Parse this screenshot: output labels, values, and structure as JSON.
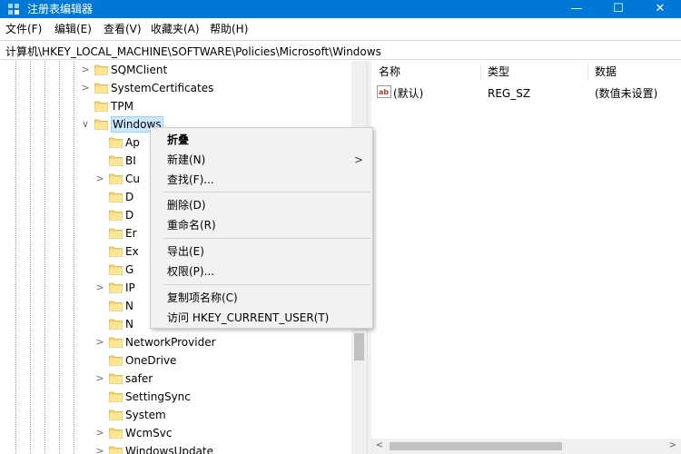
{
  "window": {
    "title": "注册表编辑器",
    "controls": {
      "minimize": "—",
      "maximize": "☐",
      "close": "✕"
    },
    "icon": "registry-editor-icon",
    "accent_color": "#0078d7"
  },
  "menu": [
    "文件(F)",
    "编辑(E)",
    "查看(V)",
    "收藏夹(A)",
    "帮助(H)"
  ],
  "address": "计算机\\HKEY_LOCAL_MACHINE\\SOFTWARE\\Policies\\Microsoft\\Windows",
  "tree": {
    "items": [
      {
        "label": "SQMClient",
        "expander": ">"
      },
      {
        "label": "SystemCertificates",
        "expander": ">"
      },
      {
        "label": "TPM",
        "expander": ""
      },
      {
        "label": "Windows",
        "expander": "∨",
        "selected": true
      },
      {
        "label": "Ap",
        "expander": ""
      },
      {
        "label": "BI",
        "expander": ""
      },
      {
        "label": "Cu",
        "expander": ">"
      },
      {
        "label": "D",
        "expander": ""
      },
      {
        "label": "D",
        "expander": ""
      },
      {
        "label": "Er",
        "expander": ""
      },
      {
        "label": "Ex",
        "expander": ""
      },
      {
        "label": "G",
        "expander": ""
      },
      {
        "label": "IP",
        "expander": ">"
      },
      {
        "label": "N",
        "expander": ""
      },
      {
        "label": "N",
        "expander": ""
      },
      {
        "label": "NetworkProvider",
        "expander": ">"
      },
      {
        "label": "OneDrive",
        "expander": ""
      },
      {
        "label": "safer",
        "expander": ">"
      },
      {
        "label": "SettingSync",
        "expander": ""
      },
      {
        "label": "System",
        "expander": ""
      },
      {
        "label": "WcmSvc",
        "expander": ">"
      },
      {
        "label": "WindowsUpdate",
        "expander": ">"
      }
    ]
  },
  "list": {
    "columns": [
      "名称",
      "类型",
      "数据"
    ],
    "rows": [
      {
        "name": "(默认)",
        "type": "REG_SZ",
        "data": "(数值未设置)",
        "icon": "string-value-icon"
      }
    ]
  },
  "scroll": {
    "left_arrow": "<",
    "right_arrow": ">"
  },
  "context_menu": {
    "items": [
      "折叠",
      "新建(N)",
      "查找(F)...",
      "删除(D)",
      "重命名(R)",
      "导出(E)",
      "权限(P)...",
      "复制项名称(C)",
      "访问 HKEY_CURRENT_USER(T)"
    ],
    "submenu_arrow": ">"
  }
}
